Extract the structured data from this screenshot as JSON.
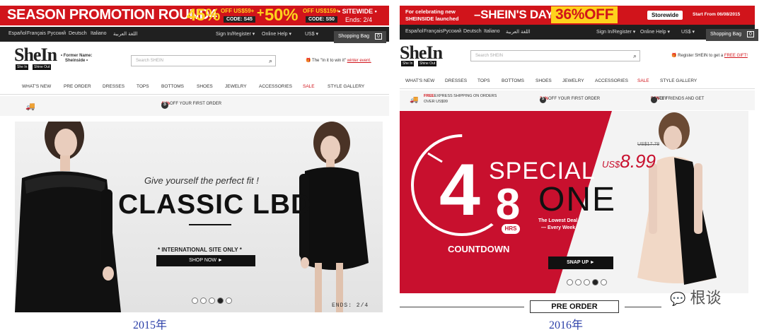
{
  "left": {
    "promo": {
      "title": "SEASON PROMOTION ROUND4",
      "pct1": "45%",
      "off1": "OFF US$59+",
      "code1": "CODE: S45",
      "plus": "+",
      "pct2": "50%",
      "off2": "OFF US$159+",
      "code2": "CODE: S50",
      "sitewide": "• SITEWIDE •",
      "ends": "Ends: 2/4"
    },
    "langs": [
      "Español",
      "Français",
      "Русский",
      "Deutsch",
      "Italiano",
      "اللغة العربية"
    ],
    "signin": "Sign In/Register ▾",
    "help": "Online Help ▾",
    "currency": "US$ ▾",
    "bag": "Shopping Bag",
    "bag_count": "0",
    "logo": "SheIn",
    "logo_tag1": "She In",
    "logo_tag2": "Shine Out",
    "former": "• Former Name:",
    "former_name": "Sheinside •",
    "search_placeholder": "Search SHEIN",
    "note": "The \"In it to win it\"",
    "note_link": "winter event.",
    "nav": [
      "WHAT'S NEW",
      "PRE ORDER",
      "DRESSES",
      "TOPS",
      "BOTTOMS",
      "SHOES",
      "JEWELRY",
      "ACCESSORIES",
      "SALE",
      "STYLE GALLERY"
    ],
    "strip_pct": "40%",
    "strip_text": "OFF YOUR FIRST ORDER",
    "hero": {
      "tagline": "Give yourself the perfect fit !",
      "headline": "CLASSIC LBD",
      "site_only": "* INTERNATIONAL SITE ONLY *",
      "button": "SHOP NOW ►",
      "ends": "ENDS: 2/4"
    },
    "caption": "2015年"
  },
  "right": {
    "promo": {
      "small1": "For celebrating new",
      "small2": "SHEINSIDE launched",
      "title": "–SHEIN'S DAY",
      "pct": "36%OFF",
      "storewide": "Storewide",
      "start": "Start From 06/08/2015"
    },
    "langs": [
      "Español",
      "Français",
      "Русский",
      "Deutsch",
      "Italiano",
      "اللغة العربية"
    ],
    "signin": "Sign In/Register ▾",
    "help": "Online Help ▾",
    "currency": "US$ ▾",
    "bag": "Shopping Bag",
    "bag_count": "0",
    "logo": "SheIn",
    "logo_tag1": "She In",
    "logo_tag2": "Shine Out",
    "search_placeholder": "Search SHEIN",
    "note": "Register SHEIN to get a",
    "note_link": "FREE GIFT!",
    "nav": [
      "WHAT'S NEW",
      "DRESSES",
      "TOPS",
      "BOTTOMS",
      "SHOES",
      "JEWELRY",
      "ACCESSORIES",
      "SALE",
      "STYLE GALLERY"
    ],
    "strip1a": "FREE",
    "strip1b": "EXPRESS SHIPPING ON ORDERS",
    "strip1c": "OVER US$99",
    "strip2_pct": "30%",
    "strip2": "OFF YOUR FIRST ORDER",
    "strip3": "INVITE FRIENDS AND GET",
    "strip3_pct": "50%",
    "strip3_off": "OFF",
    "hero": {
      "num4": "4",
      "num8": "8",
      "hrs": "HRS",
      "countdown": "COUNTDOWN",
      "special": "SPECIAL",
      "one": "ONE",
      "lowest": "The Lowest Deal",
      "every": "— Every Week",
      "old_price": "US$17.78",
      "price_cur": "US$",
      "price": "8.99",
      "button": "SNAP UP ►"
    },
    "pre_order": "PRE ORDER",
    "caption": "2016年",
    "watermark": "根谈"
  },
  "colors": {
    "red": "#d1141b",
    "yellow": "#ffd21c",
    "dark": "#202020",
    "caption_blue": "#2b3fa8"
  }
}
